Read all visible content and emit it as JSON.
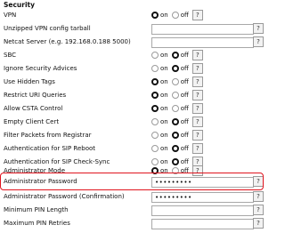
{
  "section": {
    "title": "Security"
  },
  "labels": {
    "on": "on",
    "off": "off",
    "help": "?"
  },
  "colors": {
    "highlight": "#e0141e"
  },
  "rows": {
    "vpn": {
      "label": "VPN",
      "value": "on"
    },
    "unzipped_vpn": {
      "label": "Unzipped VPN config tarball",
      "value": ""
    },
    "netcat": {
      "label": "Netcat Server (e.g. 192.168.0.188 5000)",
      "value": ""
    },
    "sbc": {
      "label": "SBC",
      "value": "off"
    },
    "ignore_advices": {
      "label": "Ignore Security Advices",
      "value": "off"
    },
    "hidden_tags": {
      "label": "Use Hidden Tags",
      "value": "on"
    },
    "restrict_uri": {
      "label": "Restrict URI Queries",
      "value": "on"
    },
    "csta": {
      "label": "Allow CSTA Control",
      "value": "on"
    },
    "empty_cert": {
      "label": "Empty Client Cert",
      "value": "off"
    },
    "filter_packets": {
      "label": "Filter Packets from Registrar",
      "value": "off"
    },
    "auth_reboot": {
      "label": "Authentication for SIP Reboot",
      "value": "off"
    },
    "auth_checksync": {
      "label": "Authentication for SIP Check-Sync",
      "value": "off"
    },
    "admin_mode": {
      "label": "Administrator Mode",
      "value": "on"
    },
    "admin_password": {
      "label": "Administrator Password",
      "value": "•••••••••"
    },
    "admin_password_confirm": {
      "label": "Administrator Password (Confirmation)",
      "value": "•••••••••"
    },
    "min_pin": {
      "label": "Minimum PIN Length",
      "value": ""
    },
    "max_pin_retries": {
      "label": "Maximum PIN Retries",
      "value": ""
    }
  }
}
